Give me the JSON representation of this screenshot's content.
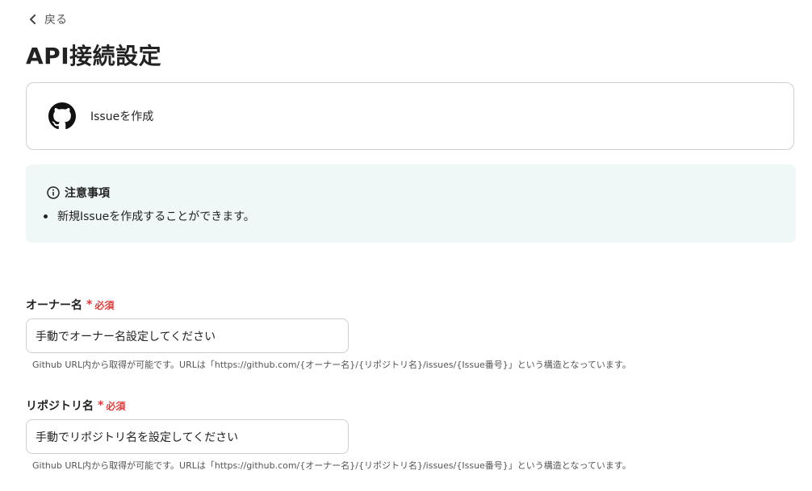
{
  "nav": {
    "back_label": "戻る"
  },
  "page": {
    "title": "API接続設定"
  },
  "action": {
    "label": "Issueを作成",
    "icon": "github-icon"
  },
  "notice": {
    "icon": "info-icon",
    "title": "注意事項",
    "items": [
      "新規Issueを作成することができます。"
    ]
  },
  "fields": [
    {
      "label": "オーナー名",
      "required_mark": "*",
      "required_text": "必須",
      "value": "手動でオーナー名設定してください",
      "help": "Github URL内から取得が可能です。URLは「https://github.com/{オーナー名}/{リポジトリ名}/issues/{Issue番号}」という構造となっています。"
    },
    {
      "label": "リポジトリ名",
      "required_mark": "*",
      "required_text": "必須",
      "value": "手動でリポジトリ名を設定してください",
      "help": "Github URL内から取得が可能です。URLは「https://github.com/{オーナー名}/{リポジトリ名}/issues/{Issue番号}」という構造となっています。"
    }
  ],
  "colors": {
    "required": "#e03a3a",
    "notice_bg": "#eff8f7",
    "border": "#cfcfcf"
  }
}
